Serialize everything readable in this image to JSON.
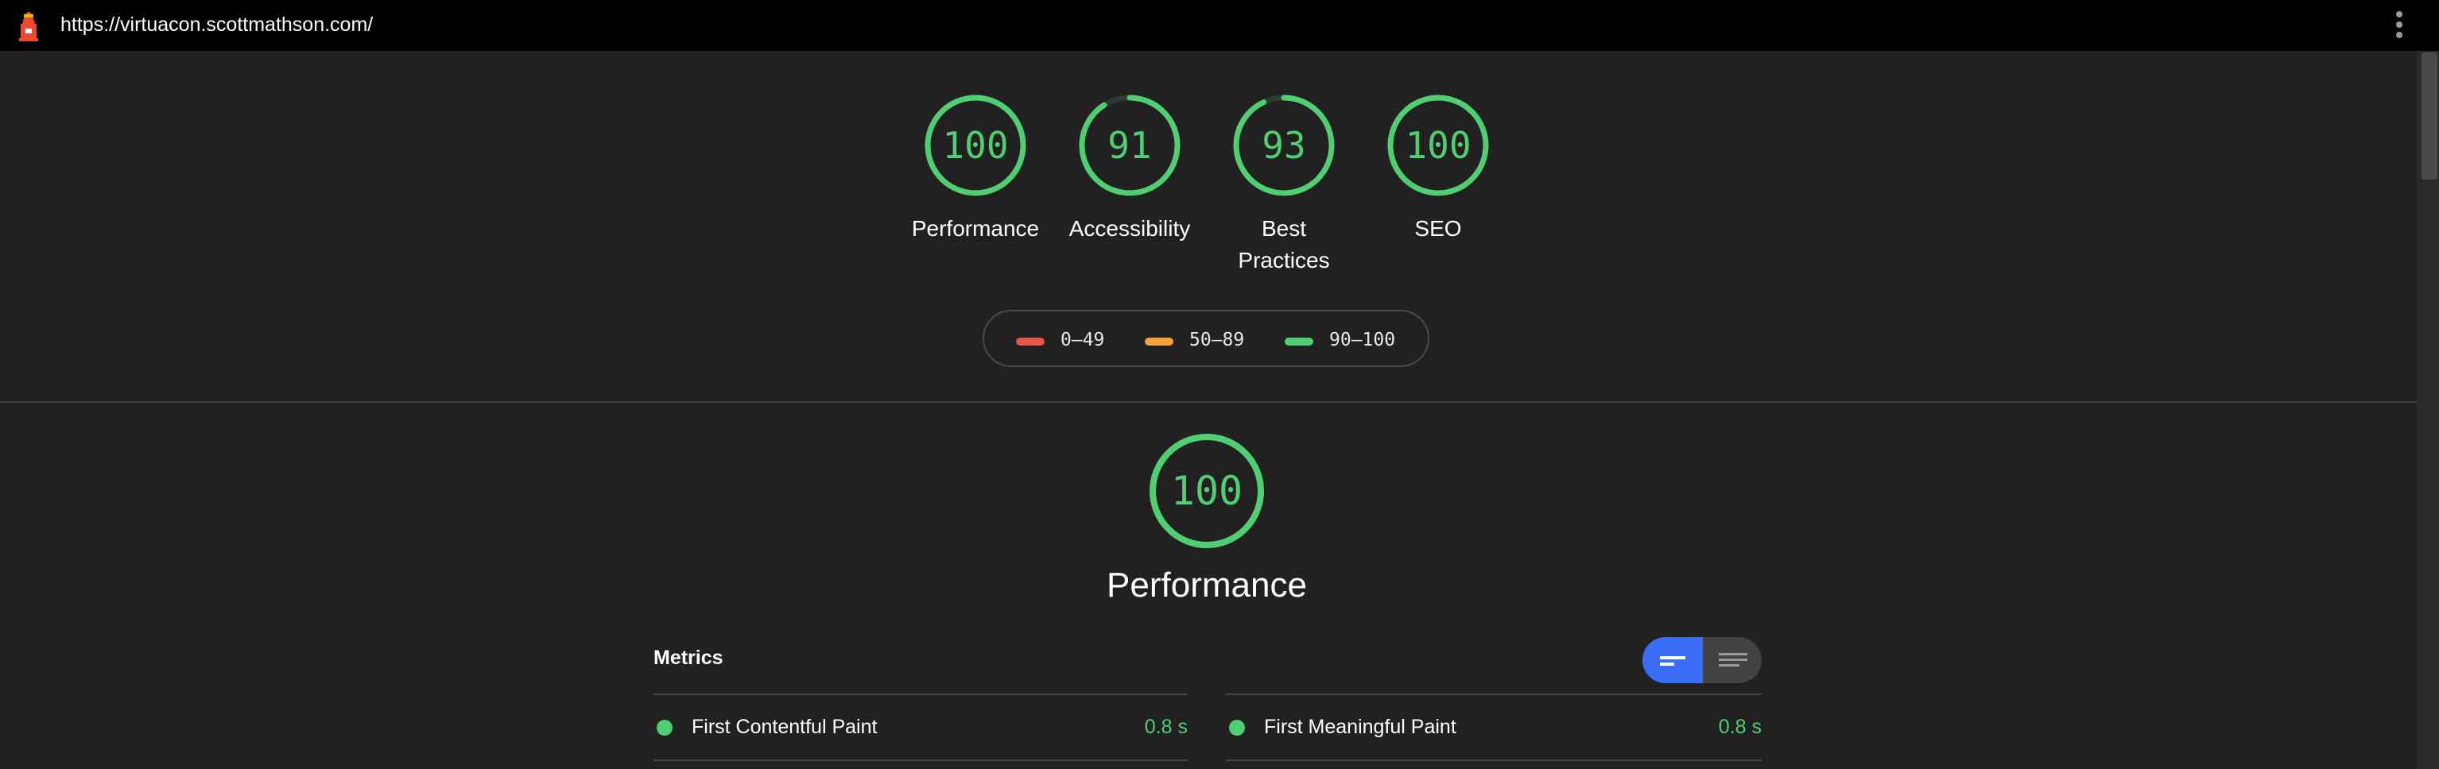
{
  "url": "https://virtuacon.scottmathson.com/",
  "icons": {
    "logo": "lighthouse-icon",
    "menu": "more-vert-icon"
  },
  "colors": {
    "pass": "#4fcf72",
    "average": "#f4a338",
    "fail": "#e8554a",
    "accent": "#3b6ef8"
  },
  "gauges": [
    {
      "label": "Performance",
      "score": "100",
      "value": 100
    },
    {
      "label": "Accessibility",
      "score": "91",
      "value": 91
    },
    {
      "label_line1": "Best",
      "label_line2": "Practices",
      "score": "93",
      "value": 93
    },
    {
      "label": "SEO",
      "score": "100",
      "value": 100
    }
  ],
  "legend": [
    {
      "range": "0–49",
      "color": "#e8554a"
    },
    {
      "range": "50–89",
      "color": "#f4a338"
    },
    {
      "range": "90–100",
      "color": "#4fcf72"
    }
  ],
  "performance": {
    "score": "100",
    "value": 100,
    "title": "Performance"
  },
  "metrics": {
    "title": "Metrics",
    "items": [
      {
        "name": "First Contentful Paint",
        "value": "0.8 s"
      },
      {
        "name": "First Meaningful Paint",
        "value": "0.8 s"
      }
    ]
  }
}
